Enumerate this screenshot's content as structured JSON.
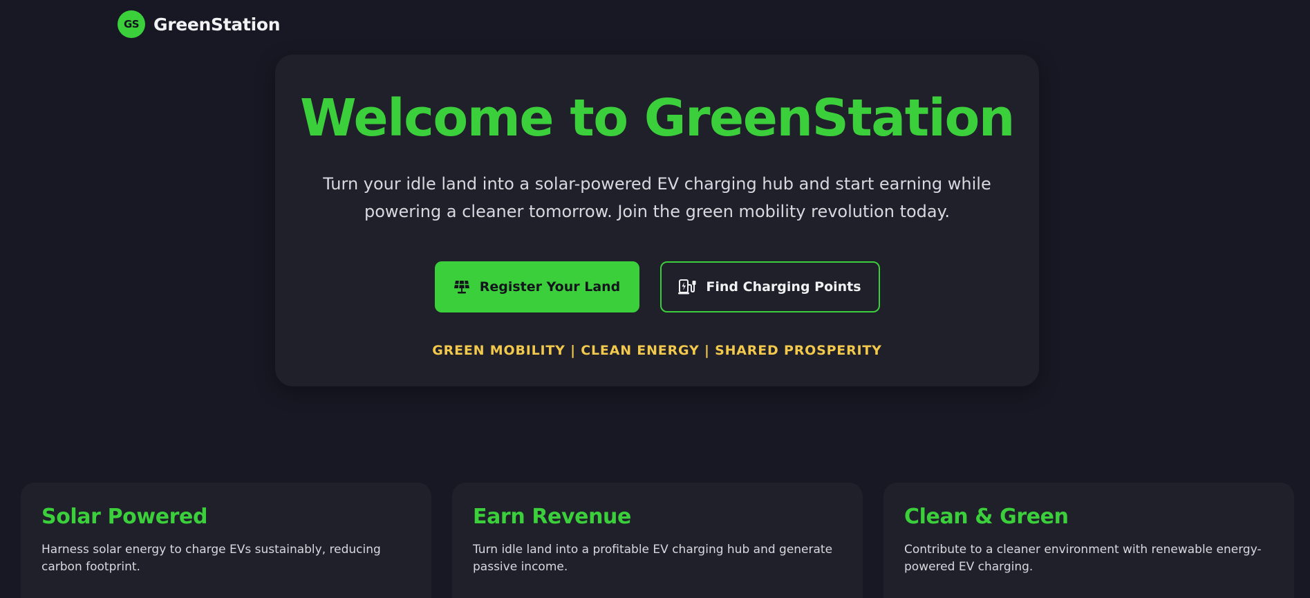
{
  "brand": {
    "badge": "GS",
    "name": "GreenStation",
    "accent_color": "#3ccf3c"
  },
  "hero": {
    "title": "Welcome to GreenStation",
    "subtitle": "Turn your idle land into a solar-powered EV charging hub and start earning while powering a cleaner tomorrow. Join the green mobility revolution today.",
    "primary_button": {
      "label": "Register Your Land",
      "icon": "solar-panel-icon"
    },
    "secondary_button": {
      "label": "Find Charging Points",
      "icon": "charging-station-icon"
    },
    "tagline": "GREEN MOBILITY | CLEAN ENERGY | SHARED PROSPERITY",
    "tagline_color": "#f2c94c"
  },
  "features": [
    {
      "title": "Solar Powered",
      "description": "Harness solar energy to charge EVs sustainably, reducing carbon footprint."
    },
    {
      "title": "Earn Revenue",
      "description": "Turn idle land into a profitable EV charging hub and generate passive income."
    },
    {
      "title": "Clean & Green",
      "description": "Contribute to a cleaner environment with renewable energy-powered EV charging."
    }
  ]
}
